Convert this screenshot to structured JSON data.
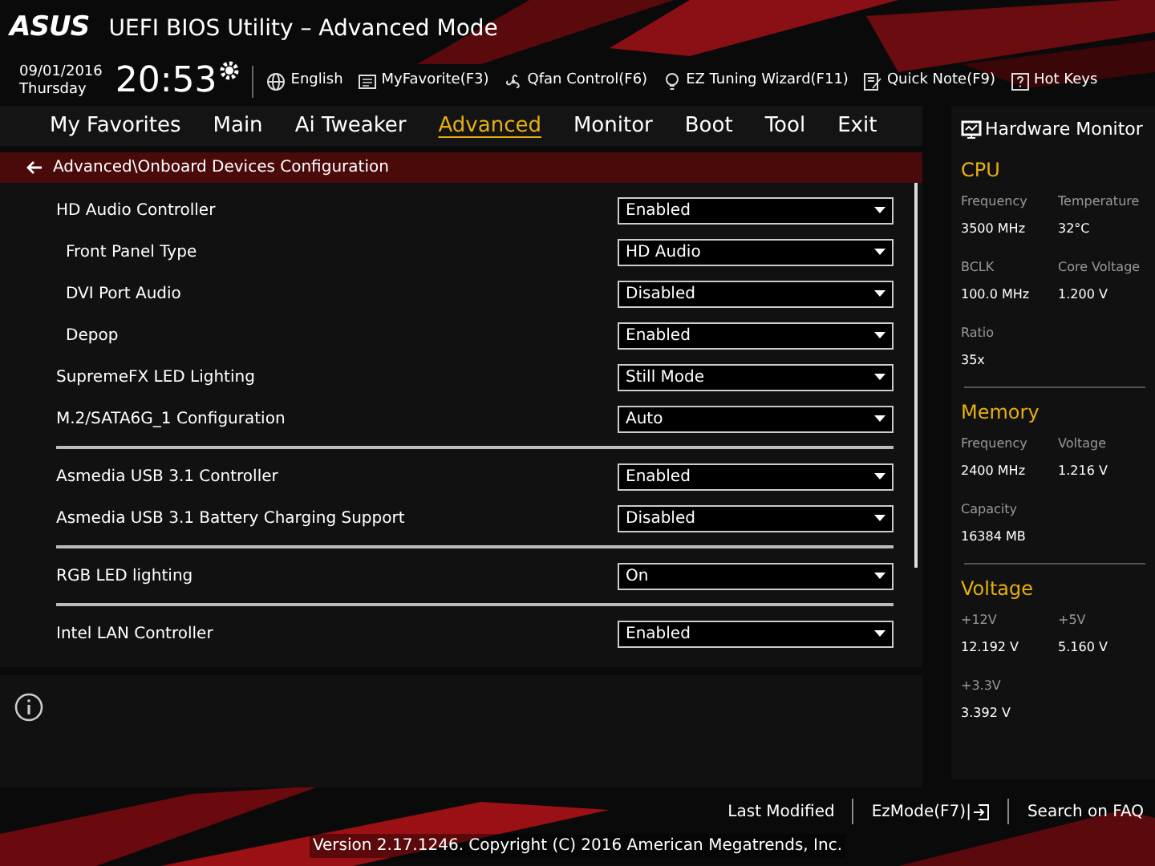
{
  "header": {
    "logo": "ASUS",
    "title": "UEFI BIOS Utility – Advanced Mode",
    "date": "09/01/2016",
    "day": "Thursday",
    "time": "20:53",
    "tools": [
      {
        "label": "English"
      },
      {
        "label": "MyFavorite(F3)"
      },
      {
        "label": "Qfan Control(F6)"
      },
      {
        "label": "EZ Tuning Wizard(F11)"
      },
      {
        "label": "Quick Note(F9)"
      },
      {
        "label": "Hot Keys"
      }
    ]
  },
  "tabs": [
    {
      "label": "My Favorites",
      "selected": false
    },
    {
      "label": "Main",
      "selected": false
    },
    {
      "label": "Ai Tweaker",
      "selected": false
    },
    {
      "label": "Advanced",
      "selected": true
    },
    {
      "label": "Monitor",
      "selected": false
    },
    {
      "label": "Boot",
      "selected": false
    },
    {
      "label": "Tool",
      "selected": false
    },
    {
      "label": "Exit",
      "selected": false
    }
  ],
  "breadcrumb": "Advanced\\Onboard Devices Configuration",
  "groups": [
    [
      {
        "label": "HD Audio Controller",
        "value": "Enabled",
        "children": [
          {
            "label": "Front Panel Type",
            "value": "HD Audio"
          },
          {
            "label": "DVI Port Audio",
            "value": "Disabled"
          },
          {
            "label": "Depop",
            "value": "Enabled"
          }
        ]
      },
      {
        "label": "SupremeFX LED Lighting",
        "value": "Still Mode"
      },
      {
        "label": "M.2/SATA6G_1 Configuration",
        "value": "Auto"
      }
    ],
    [
      {
        "label": "Asmedia USB 3.1 Controller",
        "value": "Enabled"
      },
      {
        "label": "Asmedia USB 3.1 Battery Charging Support",
        "value": "Disabled"
      }
    ],
    [
      {
        "label": "RGB LED lighting",
        "value": "On"
      }
    ],
    [
      {
        "label": "Intel LAN Controller",
        "value": "Enabled"
      }
    ]
  ],
  "hardware_monitor": {
    "title": "Hardware Monitor",
    "sections": [
      {
        "title": "CPU",
        "items": [
          {
            "label": "Frequency",
            "value": "3500 MHz"
          },
          {
            "label": "Temperature",
            "value": "32°C"
          },
          {
            "label": "BCLK",
            "value": "100.0 MHz"
          },
          {
            "label": "Core Voltage",
            "value": "1.200 V"
          },
          {
            "label": "Ratio",
            "value": "35x"
          }
        ]
      },
      {
        "title": "Memory",
        "items": [
          {
            "label": "Frequency",
            "value": "2400 MHz"
          },
          {
            "label": "Voltage",
            "value": "1.216 V"
          },
          {
            "label": "Capacity",
            "value": "16384 MB"
          }
        ]
      },
      {
        "title": "Voltage",
        "items": [
          {
            "label": "+12V",
            "value": "12.192 V"
          },
          {
            "label": "+5V",
            "value": "5.160 V"
          },
          {
            "label": "+3.3V",
            "value": "3.392 V"
          }
        ]
      }
    ]
  },
  "footer": {
    "links": [
      {
        "label": "Last Modified"
      },
      {
        "label": "EzMode(F7)|"
      },
      {
        "label": "Search on FAQ"
      }
    ],
    "version": "Version 2.17.1246. Copyright (C) 2016 American Megatrends, Inc."
  }
}
